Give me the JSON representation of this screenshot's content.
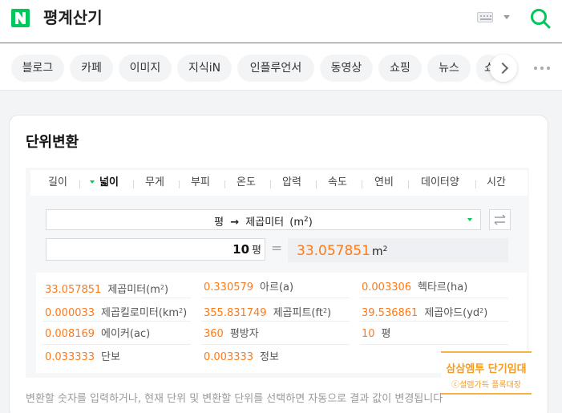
{
  "header": {
    "query": "평계산기"
  },
  "tabs": {
    "items": [
      "블로그",
      "카페",
      "이미지",
      "지식iN",
      "인플루언서",
      "동영상",
      "쇼핑",
      "뉴스",
      "쇼"
    ]
  },
  "converter": {
    "title": "단위변환",
    "unit_tabs": [
      "길이",
      "넓이",
      "무게",
      "부피",
      "온도",
      "압력",
      "속도",
      "연비",
      "데이터양",
      "시간"
    ],
    "active_tab": "넓이",
    "selector": {
      "from": "평",
      "arrow": "→",
      "to": "제곱미터",
      "to_abbr_prefix": "(m",
      "to_abbr_sup": "2",
      "to_abbr_suffix": ")"
    },
    "input": {
      "value": "10",
      "unit": "평"
    },
    "equals": "=",
    "result": {
      "value": "33.057851",
      "unit": "m",
      "unit_sup": "2"
    },
    "results": [
      {
        "value": "33.057851",
        "unit": "제곱미터(m",
        "sup": "2",
        "suffix": ")"
      },
      {
        "value": "0.330579",
        "unit": "아르(a)",
        "sup": "",
        "suffix": ""
      },
      {
        "value": "0.003306",
        "unit": "헥타르(ha)",
        "sup": "",
        "suffix": ""
      },
      {
        "value": "0.000033",
        "unit": "제곱킬로미터(km",
        "sup": "2",
        "suffix": ")"
      },
      {
        "value": "355.831749",
        "unit": "제곱피트(ft",
        "sup": "2",
        "suffix": ")"
      },
      {
        "value": "39.536861",
        "unit": "제곱야드(yd",
        "sup": "2",
        "suffix": ")"
      },
      {
        "value": "0.008169",
        "unit": "에이커(ac)",
        "sup": "",
        "suffix": ""
      },
      {
        "value": "360",
        "unit": "평방자",
        "sup": "",
        "suffix": ""
      },
      {
        "value": "10",
        "unit": "평",
        "sup": "",
        "suffix": ""
      },
      {
        "value": "0.033333",
        "unit": "단보",
        "sup": "",
        "suffix": ""
      },
      {
        "value": "0.003333",
        "unit": "정보",
        "sup": "",
        "suffix": ""
      }
    ],
    "help_text": "변환할 숫자를 입력하거나, 현재 단위 및 변환할 단위를 선택하면 자동으로 결과 값이 변경됩니다"
  },
  "ad": {
    "line1": "삼삼엠투 단기임대",
    "line2": "ⓒ설렘가득 플록대장"
  },
  "colors": {
    "brand_green": "#03c75a",
    "result_orange": "#ff7a1a",
    "ad_orange": "#f39c26"
  },
  "icons": {
    "logo": "naver-n-logo",
    "keyboard": "keyboard-icon",
    "search": "search-icon",
    "swap": "swap-arrows-icon",
    "next": "chevron-right-icon",
    "more": "more-dots-icon"
  }
}
